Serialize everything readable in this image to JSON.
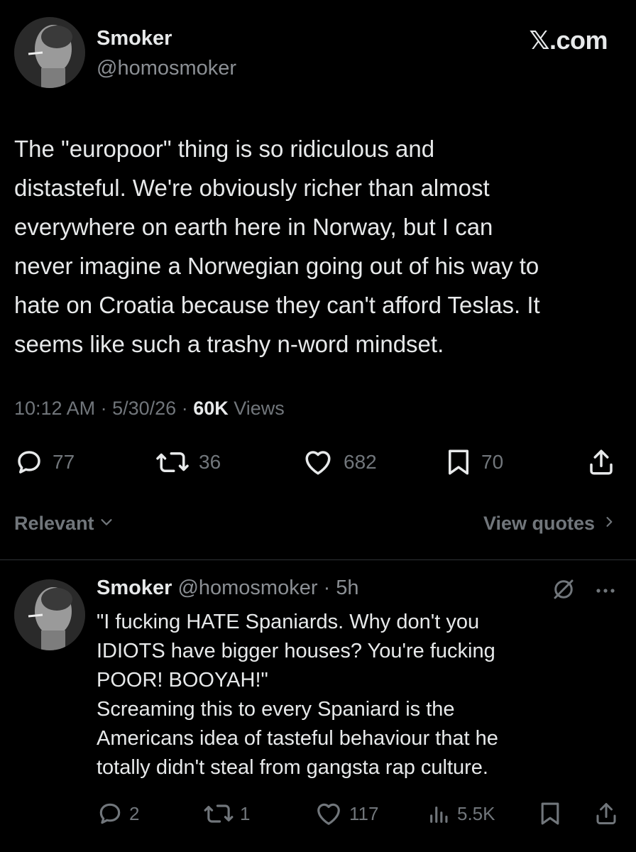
{
  "brand": {
    "label": "𝕏.com"
  },
  "tweet": {
    "name": "Smoker",
    "handle": "@homosmoker",
    "text": "The \"europoor\" thing is so ridiculous and\ndistasteful. We're obviously richer than almost\neverywhere on earth here in Norway, but I can\nnever imagine a Norwegian going out of his way to\nhate on Croatia because they can't afford Teslas. It\nseems like such a trashy n-word mindset.",
    "time": "10:12 AM",
    "date": "5/30/26",
    "views_count": "60K",
    "views_label": "Views",
    "replies": "77",
    "reposts": "36",
    "likes": "682",
    "bookmarks": "70"
  },
  "filters": {
    "sort_label": "Relevant",
    "quotes_label": "View quotes"
  },
  "reply": {
    "name": "Smoker",
    "handle": "@homosmoker",
    "time": "5h",
    "text": "\"I fucking HATE Spaniards. Why don't you\nIDIOTS have bigger houses? You're fucking\nPOOR! BOOYAH!\"\nScreaming this to every Spaniard is the\nAmericans idea of tasteful behaviour that he\ntotally didn't steal from gangsta rap culture.",
    "replies": "2",
    "reposts": "1",
    "likes": "117",
    "views": "5.5K"
  },
  "colors": {
    "background": "#000000",
    "primary_text": "#e7e9ea",
    "secondary_text": "#71767b",
    "divider": "#2f3336"
  },
  "icons": [
    "reply-icon",
    "repost-icon",
    "like-icon",
    "bookmark-icon",
    "share-icon",
    "views-icon",
    "chevron-down-icon",
    "chevron-right-icon",
    "grok-icon",
    "more-icon"
  ]
}
